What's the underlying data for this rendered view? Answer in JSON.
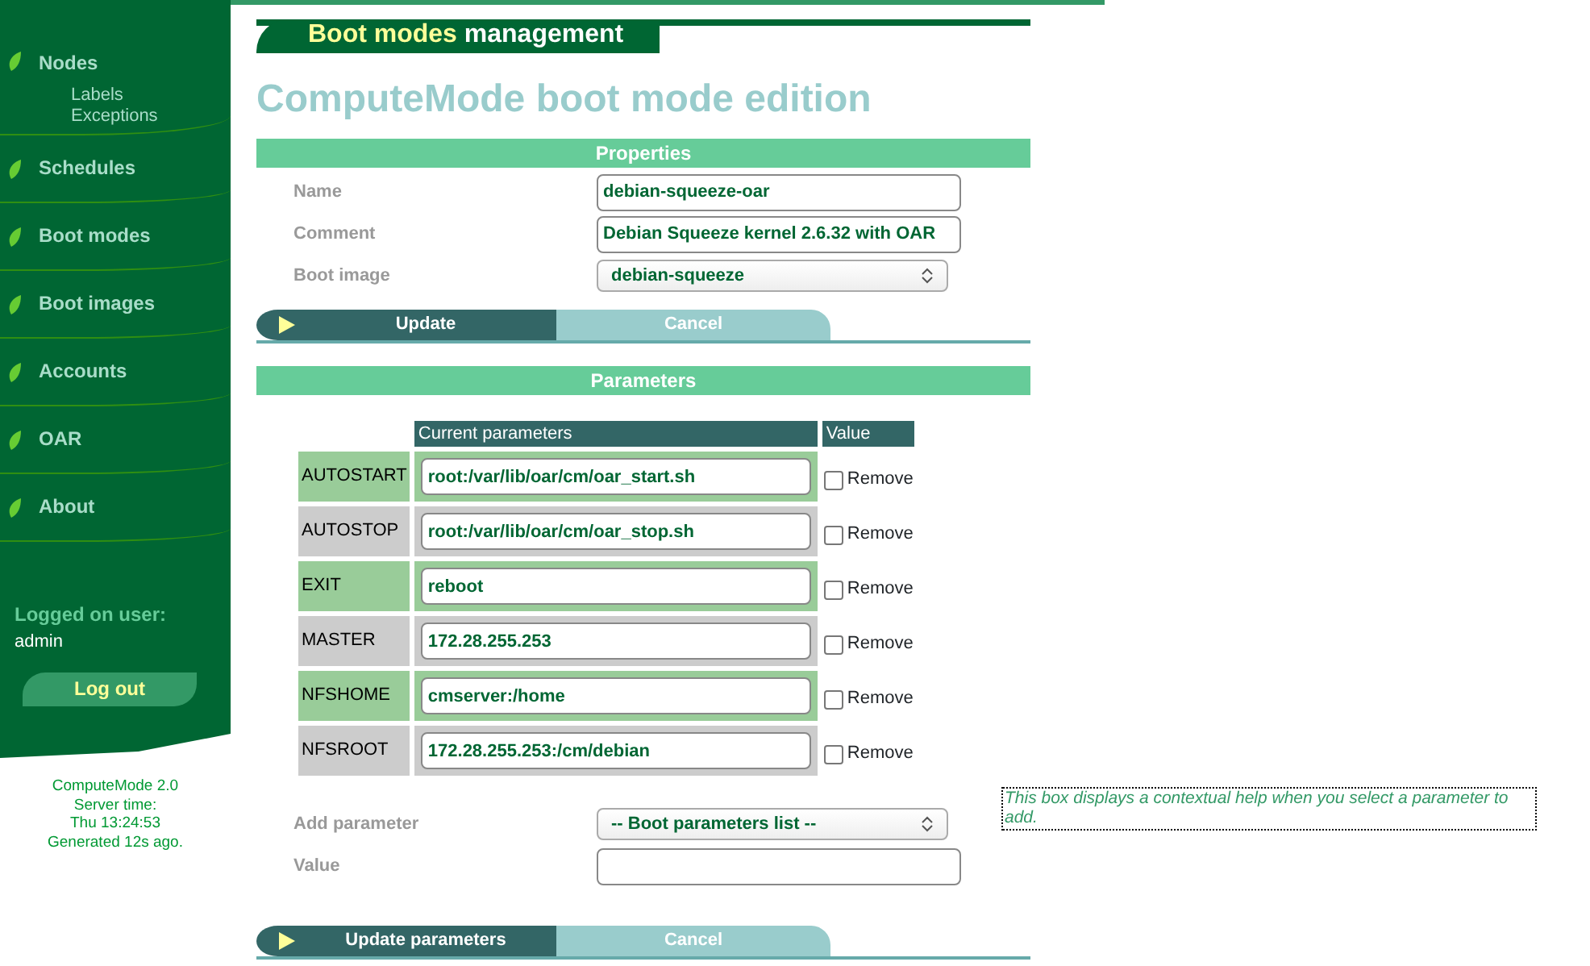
{
  "sidebar": {
    "items": [
      {
        "label": "Nodes",
        "children": [
          {
            "label": "Labels"
          },
          {
            "label": "Exceptions"
          }
        ]
      },
      {
        "label": "Schedules"
      },
      {
        "label": "Boot modes"
      },
      {
        "label": "Boot images"
      },
      {
        "label": "Accounts"
      },
      {
        "label": "OAR"
      },
      {
        "label": "About"
      }
    ],
    "user_label": "Logged on user:",
    "user": "admin",
    "logout": "Log out",
    "footer": [
      "ComputeMode 2.0",
      "Server time:",
      "Thu 13:24:53",
      "Generated 12s ago."
    ]
  },
  "header": {
    "section": "Boot modes",
    "title": "management"
  },
  "page_title": "ComputeMode boot mode edition",
  "properties": {
    "heading": "Properties",
    "fields": [
      {
        "kind": "text",
        "label": "Name",
        "value": "debian-squeeze-oar"
      },
      {
        "kind": "text",
        "label": "Comment",
        "value": "Debian Squeeze kernel 2.6.32 with OAR"
      },
      {
        "kind": "select",
        "label": "Boot image",
        "value": "debian-squeeze"
      }
    ],
    "buttons": [
      "Update",
      "Cancel"
    ]
  },
  "parameters": {
    "heading": "Parameters",
    "columns": [
      "Current parameters",
      "Value"
    ],
    "rows": [
      {
        "name": "AUTOSTART",
        "value": "root:/var/lib/oar/cm/oar_start.sh",
        "remove_label": "Remove",
        "checked": false
      },
      {
        "name": "AUTOSTOP",
        "value": "root:/var/lib/oar/cm/oar_stop.sh",
        "remove_label": "Remove",
        "checked": false
      },
      {
        "name": "EXIT",
        "value": "reboot",
        "remove_label": "Remove",
        "checked": false
      },
      {
        "name": "MASTER",
        "value": "172.28.255.253",
        "remove_label": "Remove",
        "checked": false
      },
      {
        "name": "NFSHOME",
        "value": "cmserver:/home",
        "remove_label": "Remove",
        "checked": false
      },
      {
        "name": "NFSROOT",
        "value": "172.28.255.253:/cm/debian",
        "remove_label": "Remove",
        "checked": false
      }
    ],
    "fields": [
      {
        "kind": "select",
        "label": "Add parameter",
        "value": "-- Boot parameters list --"
      },
      {
        "kind": "text",
        "label": "Value"
      }
    ],
    "buttons": [
      "Update parameters",
      "Cancel"
    ],
    "help": "This box displays a contextual help when you select a parameter to add."
  }
}
